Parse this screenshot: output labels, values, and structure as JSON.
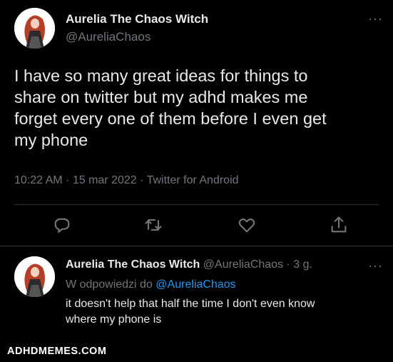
{
  "tweet": {
    "display_name": "Aurelia The Chaos Witch",
    "handle": "@AureliaChaos",
    "text_lines": [
      "I have so many great ideas for things to",
      "share on twitter but my adhd makes me",
      "forget every one of them before I even get",
      "my phone"
    ],
    "meta": "10:22 AM · 15 mar 2022 · Twitter for Android",
    "more_label": "···"
  },
  "actions": {
    "icons": [
      "reply-icon",
      "retweet-icon",
      "like-icon",
      "share-icon"
    ]
  },
  "reply": {
    "display_name": "Aurelia The Chaos Witch",
    "handle_time": "@AureliaChaos · 3 g.",
    "replying_prefix": "W odpowiedzi do",
    "replying_to": "@AureliaChaos",
    "text_lines": [
      "it doesn't help that half the time I don't even know",
      "where my phone is"
    ],
    "more_label": "···"
  },
  "watermark": "ADHDMEMES.COM",
  "colors": {
    "background": "#000000",
    "text": "#e7e9ea",
    "muted": "#71767b",
    "link": "#1d9bf0",
    "divider": "#2f3336"
  }
}
